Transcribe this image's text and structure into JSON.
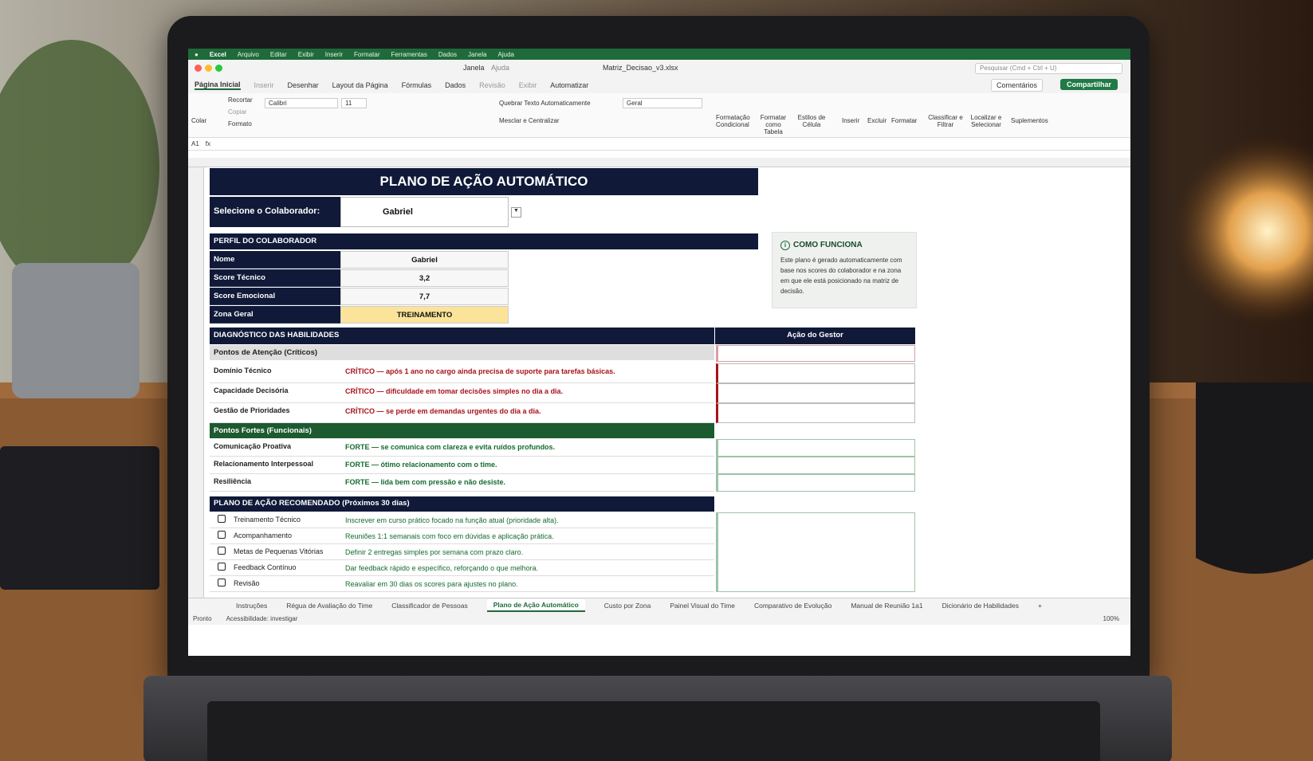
{
  "menu": {
    "app": "Excel",
    "items": [
      "Arquivo",
      "Editar",
      "Exibir",
      "Inserir",
      "Formatar",
      "Ferramentas",
      "Dados",
      "Janela",
      "Ajuda"
    ]
  },
  "title": {
    "doc": "Matriz_Decisao_v3.xlsx",
    "search_placeholder": "Pesquisar (Cmd + Ctrl + U)",
    "janela": "Janela",
    "ajuda": "Ajuda"
  },
  "tabs": [
    "Página Inicial",
    "Inserir",
    "Desenhar",
    "Layout da Página",
    "Fórmulas",
    "Dados",
    "Revisão",
    "Exibir",
    "Automatizar"
  ],
  "actions": {
    "comments": "Comentários",
    "share": "Compartilhar"
  },
  "ribbon": {
    "paste": "Colar",
    "cut": "Recortar",
    "copy": "Copiar",
    "format": "Formato",
    "font": "Calibri",
    "size": "11",
    "wrap": "Quebrar Texto Automaticamente",
    "merge": "Mesclar e Centralizar",
    "numfmt": "Geral",
    "cond": "Formatação Condicional",
    "table": "Formatar como Tabela",
    "styles": "Estilos de Célula",
    "insert": "Inserir",
    "delete": "Excluir",
    "formatc": "Formatar",
    "sort": "Classificar e Filtrar",
    "find": "Localizar e Selecionar",
    "addins": "Suplementos"
  },
  "namebox": "A1",
  "sheet": {
    "title": "PLANO DE AÇÃO AUTOMÁTICO",
    "select_label": "Selecione o Colaborador:",
    "select_value": "Gabriel",
    "profile_header": "PERFIL DO COLABORADOR",
    "profile": [
      {
        "label": "Nome",
        "value": "Gabriel"
      },
      {
        "label": "Score Técnico",
        "value": "3,2"
      },
      {
        "label": "Score Emocional",
        "value": "7,7"
      },
      {
        "label": "Zona Geral",
        "value": "TREINAMENTO"
      }
    ],
    "info": {
      "title": "COMO FUNCIONA",
      "text": "Este plano é gerado automaticamente com base nos scores do colaborador e na zona em que ele está posicionado na matriz de decisão."
    },
    "diag_header": "DIAGNÓSTICO DAS HABILIDADES",
    "action_header": "Ação do Gestor",
    "attention_header": "Pontos de Atenção (Críticos)",
    "attention": [
      {
        "skill": "Domínio Técnico",
        "text": "CRÍTICO — após 1 ano no cargo ainda precisa de suporte para tarefas básicas."
      },
      {
        "skill": "Capacidade Decisória",
        "text": "CRÍTICO — dificuldade em tomar decisões simples no dia a dia."
      },
      {
        "skill": "Gestão de Prioridades",
        "text": "CRÍTICO — se perde em demandas urgentes do dia a dia."
      }
    ],
    "strong_header": "Pontos Fortes (Funcionais)",
    "strong": [
      {
        "skill": "Comunicação Proativa",
        "text": "FORTE — se comunica com clareza e evita ruídos profundos."
      },
      {
        "skill": "Relacionamento Interpessoal",
        "text": "FORTE — ótimo relacionamento com o time."
      },
      {
        "skill": "Resiliência",
        "text": "FORTE — lida bem com pressão e não desiste."
      }
    ],
    "plan_header": "PLANO DE AÇÃO RECOMENDADO (Próximos 30 dias)",
    "plan": [
      {
        "icon": "training-icon",
        "item": "Treinamento Técnico",
        "text": "Inscrever em curso prático focado na função atual (prioridade alta)."
      },
      {
        "icon": "followup-icon",
        "item": "Acompanhamento",
        "text": "Reuniões 1:1 semanais com foco em dúvidas e aplicação prática."
      },
      {
        "icon": "goals-icon",
        "item": "Metas de Pequenas Vitórias",
        "text": "Definir 2 entregas simples por semana com prazo claro."
      },
      {
        "icon": "feedback-icon",
        "item": "Feedback Contínuo",
        "text": "Dar feedback rápido e específico, reforçando o que melhora."
      },
      {
        "icon": "review-icon",
        "item": "Revisão",
        "text": "Reavaliar em 30 dias os scores para ajustes no plano."
      }
    ]
  },
  "sheettabs": [
    "Instruções",
    "Régua de Avaliação do Time",
    "Classificador de Pessoas",
    "Plano de Ação Automático",
    "Custo por Zona",
    "Painel Visual do Time",
    "Comparativo de Evolução",
    "Manual de Reunião 1a1",
    "Dicionário de Habilidades"
  ],
  "status": {
    "ready": "Pronto",
    "access": "Acessibilidade: investigar",
    "zoom": "100%"
  },
  "colors": {
    "navy": "#101a38",
    "green": "#1f6a3a",
    "red": "#a8121a",
    "yellow": "#fbe49a"
  }
}
